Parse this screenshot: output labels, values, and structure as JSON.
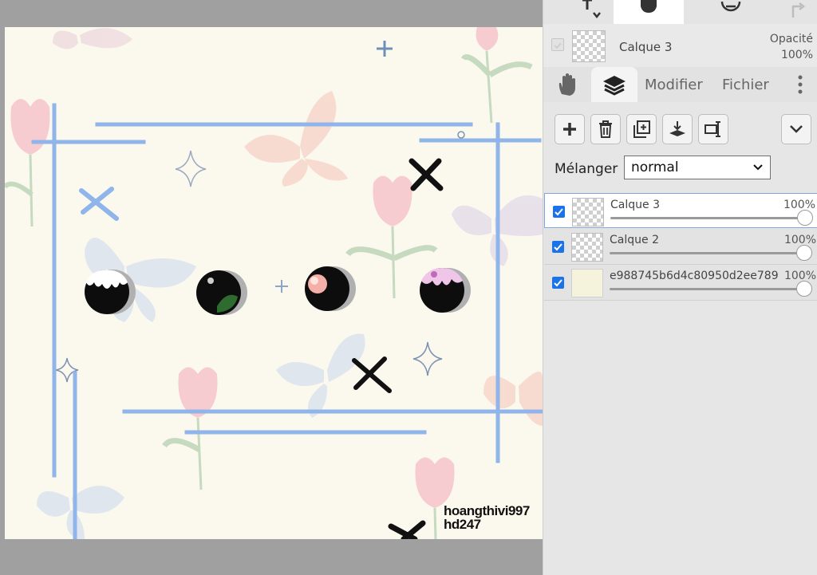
{
  "watermark": {
    "line1": "hoangthivi997",
    "line2": "hd247"
  },
  "current_layer": {
    "name": "Calque 3",
    "opacity_label": "Opacité",
    "opacity_value": "100%"
  },
  "tabs": {
    "modifier": "Modifier",
    "fichier": "Fichier"
  },
  "blend": {
    "label": "Mélanger",
    "value": "normal"
  },
  "layers": [
    {
      "name": "Calque 3",
      "opacity": "100%",
      "opacity_fraction": 1.0,
      "visible": true,
      "selected": true
    },
    {
      "name": "Calque 2",
      "opacity": "100%",
      "opacity_fraction": 1.0,
      "visible": true,
      "selected": false
    },
    {
      "name": "e988745b6d4c80950d2ee789",
      "opacity": "100%",
      "opacity_fraction": 1.0,
      "visible": true,
      "selected": false
    }
  ],
  "icons": {
    "tools": [
      "text-tool-icon",
      "hand-tool-icon",
      "minus-circle-icon",
      "redo-icon"
    ],
    "tabs": [
      "hand-icon",
      "layers-icon",
      "more-vertical-icon"
    ],
    "layer_actions": [
      "add-layer-icon",
      "delete-layer-icon",
      "duplicate-layer-icon",
      "merge-down-icon",
      "transform-icon",
      "chevron-down-icon"
    ]
  },
  "colors": {
    "accent": "#1a73e8",
    "frame_lines": "#8fb5ea"
  }
}
